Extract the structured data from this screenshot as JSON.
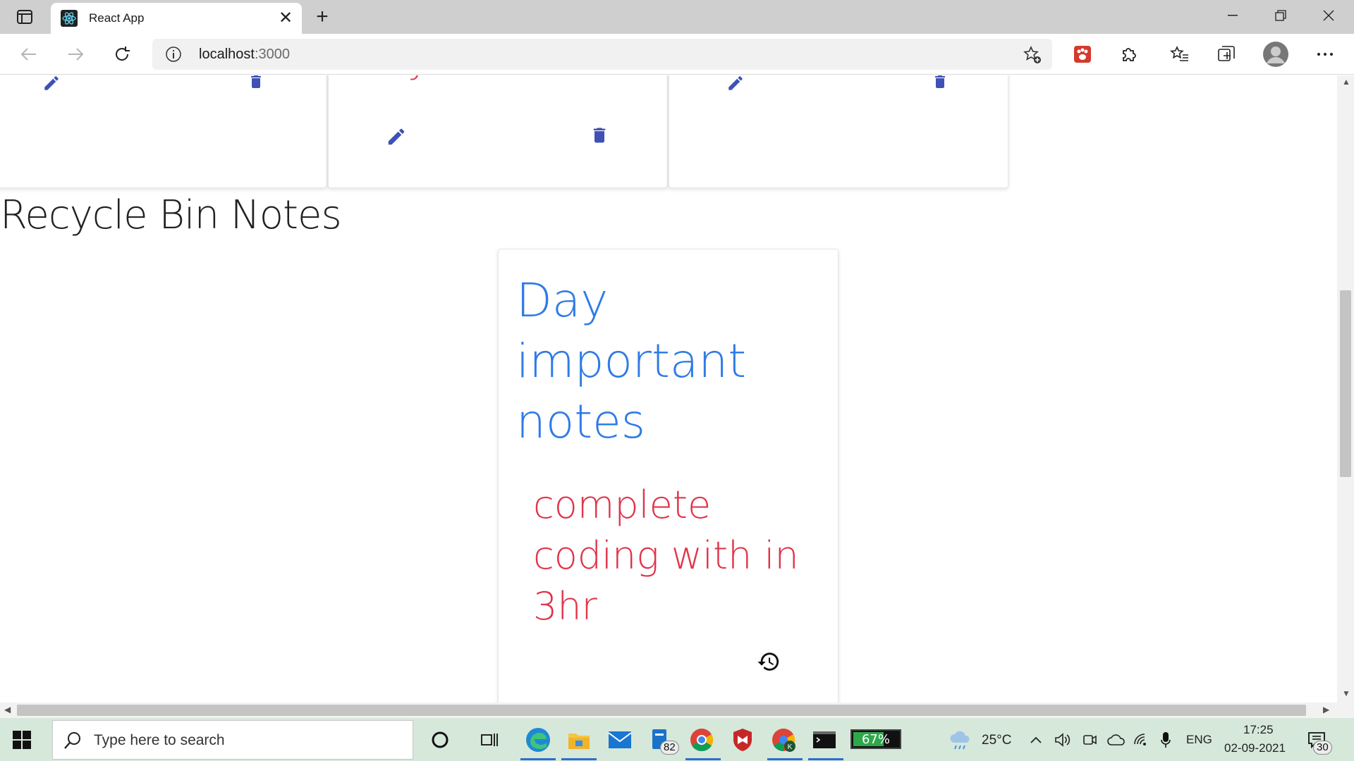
{
  "browser": {
    "tab_title": "React App",
    "address_host": "localhost",
    "address_port": ":3000"
  },
  "page": {
    "top_cards": [
      {
        "title": ""
      },
      {
        "title": "Thymeleaf"
      },
      {
        "title": ""
      }
    ],
    "section_heading": "Recycle Bin Notes",
    "bin_note": {
      "title": "Day important notes",
      "content": "complete coding with in 3hr"
    }
  },
  "taskbar": {
    "search_placeholder": "Type here to search",
    "mail_badge": "82",
    "battery": "67%",
    "battery_level": 0.67,
    "weather": "25°C",
    "language": "ENG",
    "time": "17:25",
    "date": "02-09-2021",
    "notifications": "30"
  },
  "colors": {
    "accent_blue": "#2f7be6",
    "note_red": "#e0354a",
    "icon_indigo": "#3f51b5"
  }
}
